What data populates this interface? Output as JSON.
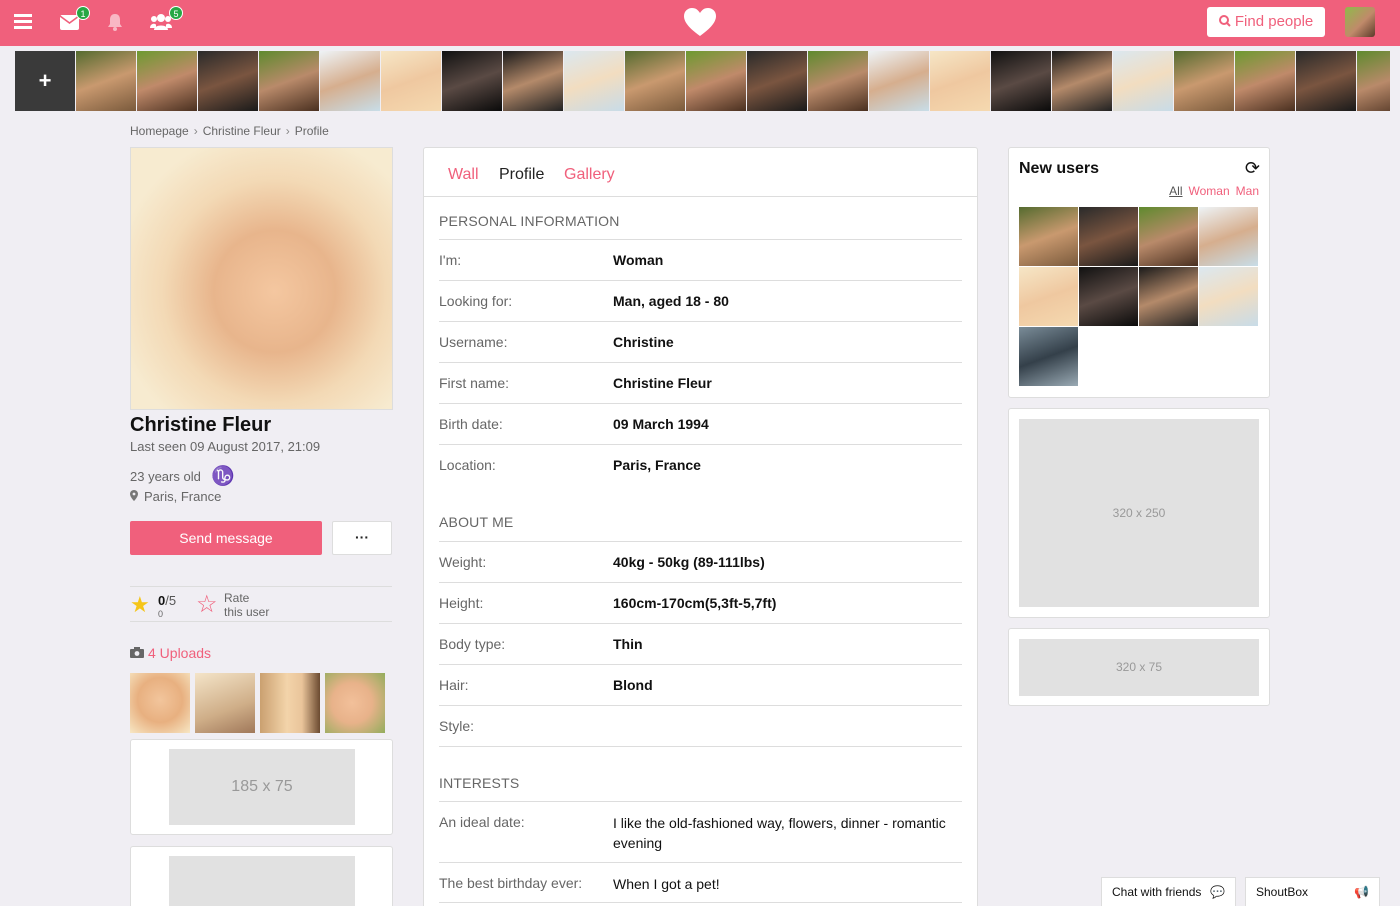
{
  "topbar": {
    "messages_badge": "1",
    "friends_badge": "5",
    "find_label": "Find people"
  },
  "colors": {
    "accent": "#f0607c",
    "badge": "#27a744",
    "background": "#f0eef3"
  },
  "icons": {
    "menu": "bars-icon",
    "messages": "envelope-icon",
    "notifications": "bell-icon",
    "friends": "users-icon",
    "logo": "heart-icon",
    "search": "search-icon",
    "refresh": "refresh-icon",
    "camera": "camera-icon",
    "location": "map-marker-icon",
    "chat": "comments-icon",
    "shoutbox": "bullhorn-icon"
  },
  "strip": {
    "add_label": "+"
  },
  "breadcrumb": [
    "Homepage",
    "Christine Fleur",
    "Profile"
  ],
  "profile": {
    "name": "Christine Fleur",
    "last_seen": "Last seen 09 August 2017, 21:09",
    "age": "23 years old",
    "zodiac": "♑",
    "location": "Paris, France",
    "send_label": "Send message",
    "more_label": "···",
    "rating_value": "0",
    "rating_max": "/5",
    "rating_count": "0",
    "rate_line1": "Rate",
    "rate_line2": "this user",
    "uploads_label": "4 Uploads"
  },
  "ads": {
    "left_small": "185 x 75",
    "right_large": "320 x 250",
    "right_small": "320 x 75"
  },
  "tabs": [
    "Wall",
    "Profile",
    "Gallery"
  ],
  "sections": {
    "personal": "PERSONAL INFORMATION",
    "about": "ABOUT ME",
    "interests": "INTERESTS"
  },
  "personal": [
    {
      "label": "I'm:",
      "value": "Woman"
    },
    {
      "label": "Looking for:",
      "value": "Man, aged 18 - 80"
    },
    {
      "label": "Username:",
      "value": "Christine"
    },
    {
      "label": "First name:",
      "value": "Christine Fleur"
    },
    {
      "label": "Birth date:",
      "value": "09 March 1994"
    },
    {
      "label": "Location:",
      "value": "Paris, France"
    }
  ],
  "about": [
    {
      "label": "Weight:",
      "value": "40kg - 50kg (89-111lbs)"
    },
    {
      "label": "Height:",
      "value": "160cm-170cm(5,3ft-5,7ft)"
    },
    {
      "label": "Body type:",
      "value": "Thin"
    },
    {
      "label": "Hair:",
      "value": "Blond"
    },
    {
      "label": "Style:",
      "value": ""
    }
  ],
  "interests": [
    {
      "label": "An ideal date:",
      "value": "I like the old-fashioned way, flowers, dinner - romantic evening"
    },
    {
      "label": "The best birthday ever:",
      "value": "When I got a pet!"
    }
  ],
  "new_users": {
    "title": "New users",
    "filters": [
      "All",
      "Woman",
      "Man"
    ]
  },
  "chat": {
    "friends_label": "Chat with friends",
    "shoutbox_label": "ShoutBox"
  }
}
